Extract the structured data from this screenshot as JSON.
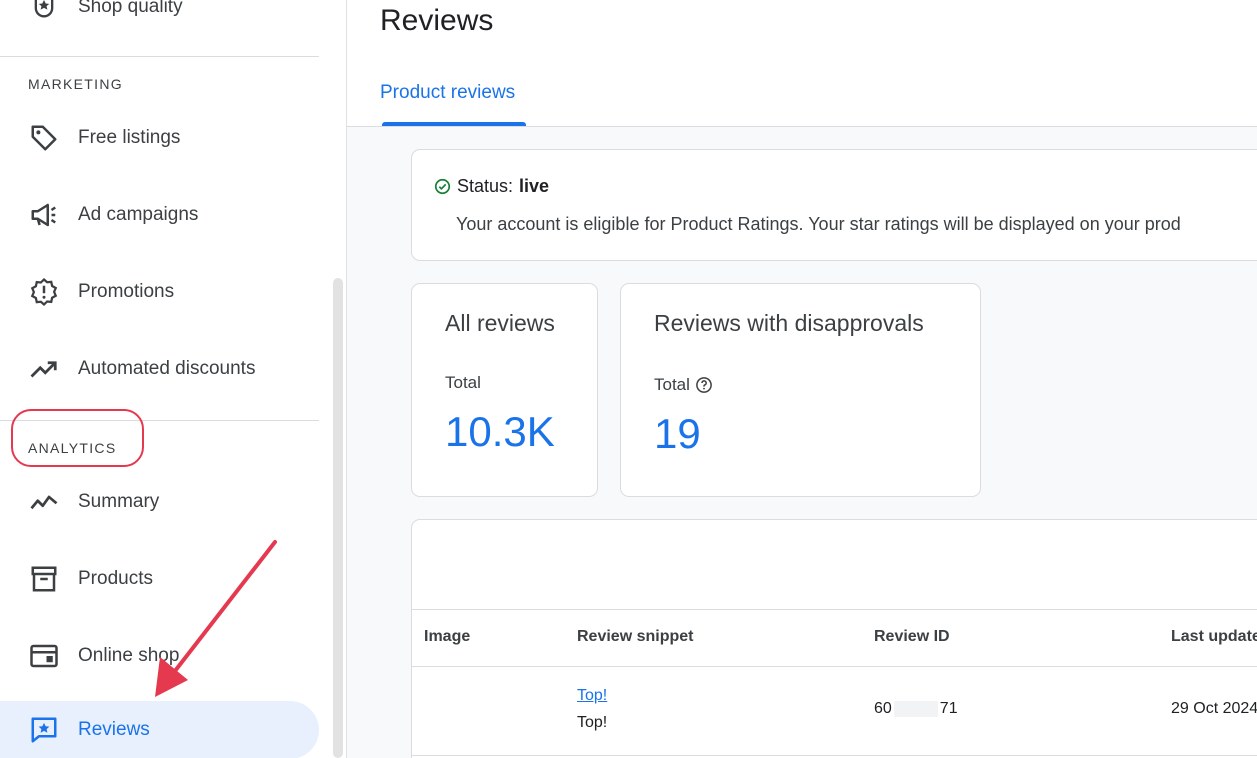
{
  "sidebar": {
    "top_item": {
      "label": "Shop quality",
      "icon": "shop-quality-icon"
    },
    "sections": [
      {
        "label": "MARKETING"
      },
      {
        "label": "ANALYTICS"
      }
    ],
    "marketing_items": [
      {
        "label": "Free listings",
        "icon": "tag-icon"
      },
      {
        "label": "Ad campaigns",
        "icon": "megaphone-icon"
      },
      {
        "label": "Promotions",
        "icon": "promotion-badge-icon"
      },
      {
        "label": "Automated discounts",
        "icon": "trending-up-icon"
      }
    ],
    "analytics_items": [
      {
        "label": "Summary",
        "icon": "line-chart-icon"
      },
      {
        "label": "Products",
        "icon": "archive-box-icon"
      },
      {
        "label": "Online shop",
        "icon": "online-shop-icon"
      },
      {
        "label": "Reviews",
        "icon": "reviews-star-icon",
        "active": true
      }
    ]
  },
  "main": {
    "title": "Reviews",
    "tabs": [
      {
        "label": "Product reviews",
        "active": true
      }
    ],
    "status": {
      "label": "Status:",
      "value": "live",
      "description": "Your account is eligible for Product Ratings. Your star ratings will be displayed on your prod"
    },
    "stats": [
      {
        "title": "All reviews",
        "sub": "Total",
        "value": "10.3K"
      },
      {
        "title": "Reviews with disapprovals",
        "sub": "Total",
        "value": "19"
      }
    ],
    "table": {
      "columns": [
        "Image",
        "Review snippet",
        "Review ID",
        "Last update"
      ],
      "rows": [
        {
          "image": "",
          "snippet_title": "Top!",
          "snippet_text": "Top!",
          "review_id_start": "60",
          "review_id_end": "71",
          "last_update": "29 Oct 2024"
        }
      ]
    }
  },
  "colors": {
    "accent": "#1a73e8",
    "active_bg": "#e8f0fe",
    "status_ok": "#188038",
    "annotation": "#e53950"
  }
}
